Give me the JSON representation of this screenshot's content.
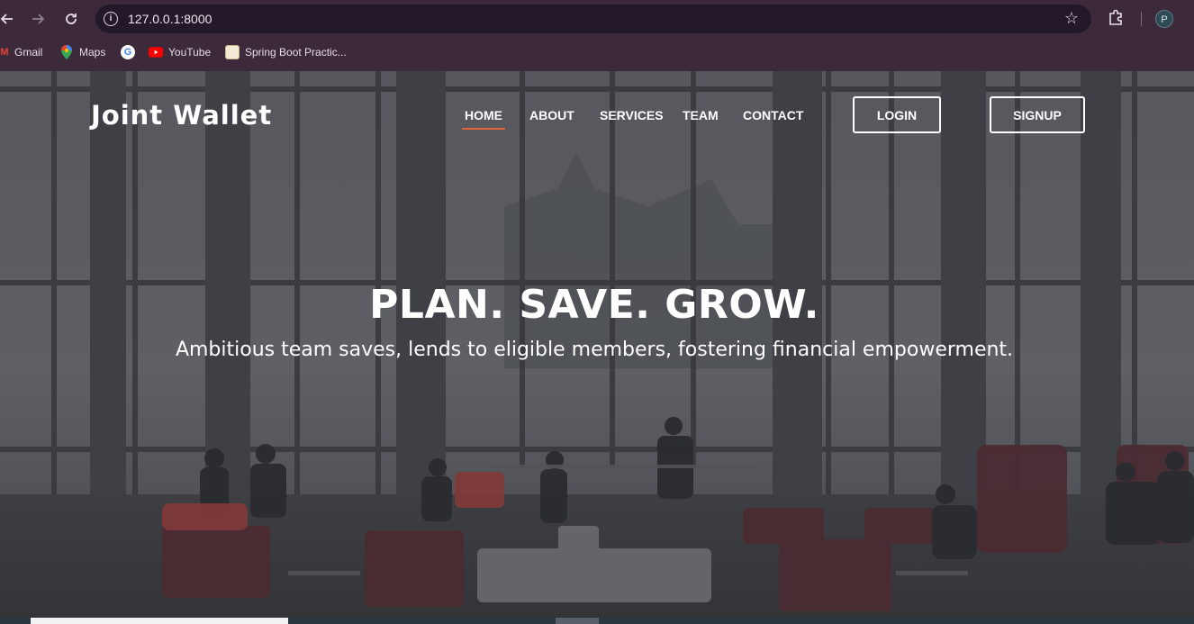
{
  "browser": {
    "url": "127.0.0.1:8000",
    "profile_initial": "P",
    "icons": {
      "back": "back-arrow-icon",
      "forward": "forward-arrow-icon",
      "reload": "reload-icon",
      "info": "site-info-icon",
      "star": "bookmark-star-icon",
      "extensions": "extensions-icon"
    },
    "bookmarks": [
      {
        "label": "Gmail",
        "icon": "gmail-icon"
      },
      {
        "label": "Maps",
        "icon": "maps-icon"
      },
      {
        "label": "",
        "icon": "google-icon"
      },
      {
        "label": "YouTube",
        "icon": "youtube-icon"
      },
      {
        "label": "Spring Boot Practic...",
        "icon": "page-icon"
      }
    ]
  },
  "site": {
    "brand": "Joint Wallet",
    "nav": [
      "HOME",
      "ABOUT",
      "SERVICES",
      "TEAM",
      "CONTACT"
    ],
    "active_nav": "HOME",
    "login_label": "LOGIN",
    "signup_label": "SIGNUP",
    "hero_title": "PLAN. SAVE. GROW.",
    "hero_subtitle": "Ambitious team saves, lends to eligible members, fostering financial empowerment.",
    "accent_color": "#e0633a"
  }
}
